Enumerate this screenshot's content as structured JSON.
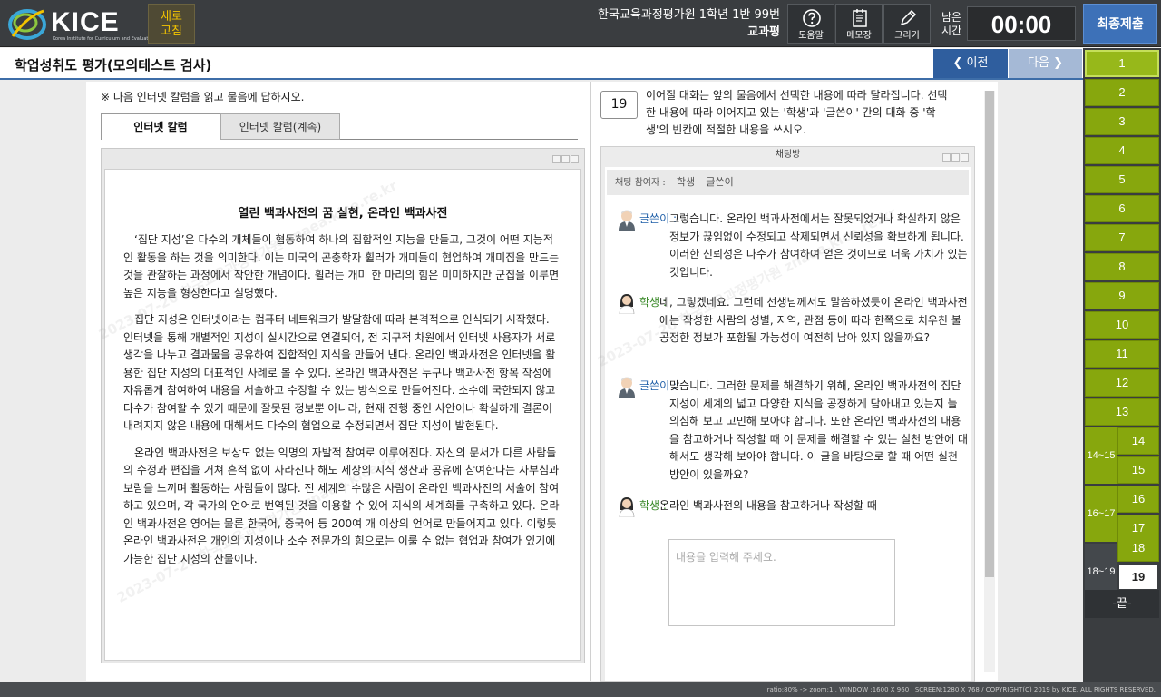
{
  "header": {
    "logo_text": "KICE",
    "logo_subtext": "Korea Institute for Curriculum and Evaluation",
    "refresh_label_1": "새로",
    "refresh_label_2": "고침",
    "exam_org": "한국교육과정평가원 1학년 1반 99번",
    "subject": "교과평",
    "tools": [
      {
        "label": "도움말",
        "icon": "help-icon"
      },
      {
        "label": "메모장",
        "icon": "notepad-icon"
      },
      {
        "label": "그리기",
        "icon": "pen-icon"
      }
    ],
    "remain_label_1": "남은",
    "remain_label_2": "시간",
    "timer": "00:00",
    "submit_label": "최종제출"
  },
  "titlebar": {
    "title": "학업성취도 평가(모의테스트 검사)",
    "prev_label": "❮ 이전",
    "next_label": "다음 ❯"
  },
  "left": {
    "instruction": "※ 다음 인터넷 칼럼을 읽고 물음에 답하시오.",
    "tabs": [
      "인터넷 칼럼",
      "인터넷 칼럼(계속)"
    ],
    "article_title": "열린 백과사전의 꿈 실현, 온라인 백과사전",
    "paragraphs": [
      "‘집단 지성’은 다수의 개체들이 협동하여 하나의 집합적인 지능을 만들고, 그것이 어떤 지능적인 활동을 하는 것을 의미한다. 이는 미국의 곤충학자 휠러가 개미들이 협업하여 개미집을 만드는 것을 관찰하는 과정에서 착안한 개념이다. 휠러는 개미 한 마리의 힘은 미미하지만 군집을 이루면 높은 지능을 형성한다고 설명했다.",
      "집단 지성은 인터넷이라는 컴퓨터 네트워크가 발달함에 따라 본격적으로 인식되기 시작했다. 인터넷을 통해 개별적인 지성이 실시간으로 연결되어, 전 지구적 차원에서 인터넷 사용자가 서로 생각을 나누고 결과물을 공유하여 집합적인 지식을 만들어 낸다. 온라인 백과사전은 인터넷을 활용한 집단 지성의 대표적인 사례로 볼 수 있다. 온라인 백과사전은 누구나 백과사전 항목 작성에 자유롭게 참여하여 내용을 서술하고 수정할 수 있는 방식으로 만들어진다. 소수에 국한되지 않고 다수가 참여할 수 있기 때문에 잘못된 정보뿐 아니라, 현재 진행 중인 사안이나 확실하게 결론이 내려지지 않은 내용에 대해서도 다수의 협업으로 수정되면서 집단 지성이 발현된다.",
      "온라인 백과사전은 보상도 없는 익명의 자발적 참여로 이루어진다. 자신의 문서가 다른 사람들의 수정과 편집을 거쳐 흔적 없이 사라진다 해도 세상의 지식 생산과 공유에 참여한다는 자부심과 보람을 느끼며 활동하는 사람들이 많다. 전 세계의 수많은 사람이 온라인 백과사전의 서술에 참여하고 있으며, 각 국가의 언어로 번역된 것을 이용할 수 있어 지식의 세계화를 구축하고 있다. 온라인 백과사전은 영어는 물론 한국어, 중국어 등 200여 개 이상의 언어로 만들어지고 있다. 이렇듯 온라인 백과사전은 개인의 지성이나 소수 전문가의 힘으로는 이룰 수 없는 협업과 참여가 있기에 가능한 집단 지성의 산물이다."
    ]
  },
  "right": {
    "question_number": "19",
    "question_text": "이어질 대화는 앞의 물음에서 선택한 내용에 따라 달라집니다. 선택한 내용에 따라 이어지고 있는 '학생'과 '글쓴이' 간의 대화 중 '학생'의 빈칸에 적절한 내용을 쓰시오.",
    "chat_title": "채팅방",
    "participants_label": "채팅 참여자 :",
    "participants": [
      "학생",
      "글쓴이"
    ],
    "messages": [
      {
        "speaker": "글쓴이",
        "role": "writer",
        "text": "그렇습니다. 온라인 백과사전에서는 잘못되었거나 확실하지 않은 정보가 끊임없이 수정되고 삭제되면서 신뢰성을 확보하게 됩니다. 이러한 신뢰성은 다수가 참여하여 얻은 것이므로 더욱 가치가 있는 것입니다."
      },
      {
        "speaker": "학생",
        "role": "student",
        "text": "네, 그렇겠네요. 그런데 선생님께서도 말씀하셨듯이 온라인 백과사전에는 작성한 사람의 성별, 지역, 관점 등에 따라 한쪽으로 치우친 불공정한 정보가 포함될 가능성이 여전히 남아 있지 않을까요?"
      },
      {
        "speaker": "글쓴이",
        "role": "writer",
        "text": "맞습니다. 그러한 문제를 해결하기 위해, 온라인 백과사전의 집단 지성이 세계의 넓고 다양한 지식을 공정하게 담아내고 있는지 늘 의심해 보고 고민해 보아야 합니다. 또한 온라인 백과사전의 내용을 참고하거나 작성할 때 이 문제를 해결할 수 있는 실천 방안에 대해서도 생각해 보아야 합니다. 이 글을 바탕으로 할 때 어떤 실천 방안이 있을까요?"
      },
      {
        "speaker": "학생",
        "role": "student",
        "text": "온라인 백과사전의 내용을 참고하거나 작성할 때"
      }
    ],
    "speaker_suffix": " :",
    "answer_placeholder": "내용을 입력해 주세요."
  },
  "qnav": {
    "items": [
      "1",
      "2",
      "3",
      "4",
      "5",
      "6",
      "7",
      "8",
      "9",
      "10",
      "11",
      "12",
      "13",
      "14",
      "15",
      "16",
      "17",
      "18",
      "19"
    ],
    "groups": [
      "14~15",
      "16~17",
      "18~19"
    ],
    "end_label": "-끝-"
  },
  "statusbar": {
    "text": "ratio:80% -> zoom:1 , WINDOW :1600 X 960 , SCREEN:1280 X 768 / COPYRIGHT(C) 2019 by KICE. ALL RIGHTS RESERVED."
  },
  "watermark": "2023-07-20 한국교육과정평가원 znaea.kice.re.kr",
  "colors": {
    "topbar": "#3a3d40",
    "accent_blue": "#3d71b8",
    "nav_green": "#87a70d",
    "writer": "#1f5fa8",
    "student": "#3b8a2a"
  }
}
